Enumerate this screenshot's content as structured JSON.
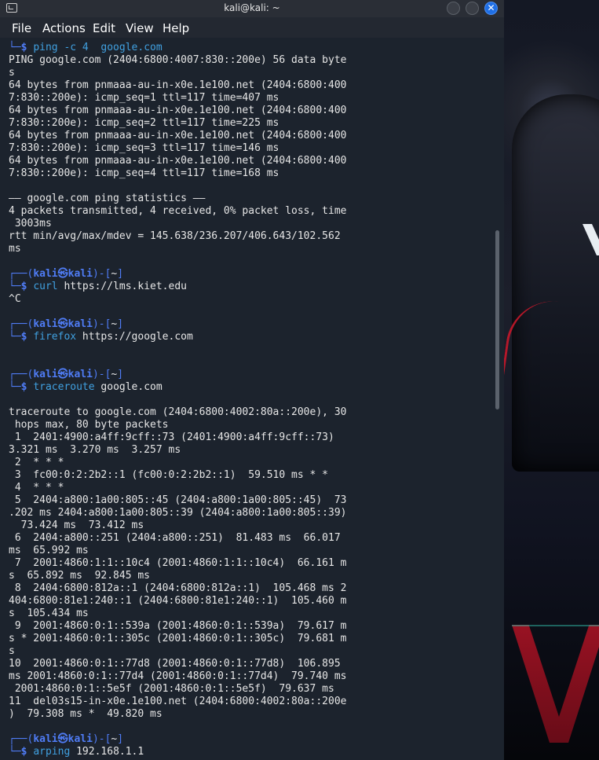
{
  "window": {
    "title": "kali@kali: ~"
  },
  "menu": [
    "File",
    "Actions",
    "Edit",
    "View",
    "Help"
  ],
  "terminal_lines": [
    {
      "t": "cmd_cont",
      "cmd": "ping -c 4  google.com"
    },
    {
      "t": "out",
      "text": "PING google.com (2404:6800:4007:830::200e) 56 data byte"
    },
    {
      "t": "out",
      "text": "s"
    },
    {
      "t": "out",
      "text": "64 bytes from pnmaaa-au-in-x0e.1e100.net (2404:6800:400"
    },
    {
      "t": "out",
      "text": "7:830::200e): icmp_seq=1 ttl=117 time=407 ms"
    },
    {
      "t": "out",
      "text": "64 bytes from pnmaaa-au-in-x0e.1e100.net (2404:6800:400"
    },
    {
      "t": "out",
      "text": "7:830::200e): icmp_seq=2 ttl=117 time=225 ms"
    },
    {
      "t": "out",
      "text": "64 bytes from pnmaaa-au-in-x0e.1e100.net (2404:6800:400"
    },
    {
      "t": "out",
      "text": "7:830::200e): icmp_seq=3 ttl=117 time=146 ms"
    },
    {
      "t": "out",
      "text": "64 bytes from pnmaaa-au-in-x0e.1e100.net (2404:6800:400"
    },
    {
      "t": "out",
      "text": "7:830::200e): icmp_seq=4 ttl=117 time=168 ms"
    },
    {
      "t": "out",
      "text": ""
    },
    {
      "t": "out",
      "text": "—— google.com ping statistics ——"
    },
    {
      "t": "out",
      "text": "4 packets transmitted, 4 received, 0% packet loss, time"
    },
    {
      "t": "out",
      "text": " 3003ms"
    },
    {
      "t": "out",
      "text": "rtt min/avg/max/mdev = 145.638/236.207/406.643/102.562"
    },
    {
      "t": "out",
      "text": "ms"
    },
    {
      "t": "out",
      "text": ""
    },
    {
      "t": "prompt_top",
      "user": "kali",
      "host": "kali",
      "dir": "~"
    },
    {
      "t": "cmd",
      "cmd": "curl",
      "arg": " https://lms.kiet.edu"
    },
    {
      "t": "out",
      "text": "^C"
    },
    {
      "t": "out",
      "text": ""
    },
    {
      "t": "prompt_top",
      "user": "kali",
      "host": "kali",
      "dir": "~"
    },
    {
      "t": "cmd",
      "cmd": "firefox",
      "arg": " https://google.com"
    },
    {
      "t": "out",
      "text": ""
    },
    {
      "t": "out",
      "text": ""
    },
    {
      "t": "prompt_top",
      "user": "kali",
      "host": "kali",
      "dir": "~"
    },
    {
      "t": "cmd",
      "cmd": "traceroute",
      "arg": " google.com"
    },
    {
      "t": "out",
      "text": ""
    },
    {
      "t": "out",
      "text": "traceroute to google.com (2404:6800:4002:80a::200e), 30"
    },
    {
      "t": "out",
      "text": " hops max, 80 byte packets"
    },
    {
      "t": "out",
      "text": " 1  2401:4900:a4ff:9cff::73 (2401:4900:a4ff:9cff::73)"
    },
    {
      "t": "out",
      "text": "3.321 ms  3.270 ms  3.257 ms"
    },
    {
      "t": "out",
      "text": " 2  * * *"
    },
    {
      "t": "out",
      "text": " 3  fc00:0:2:2b2::1 (fc00:0:2:2b2::1)  59.510 ms * *"
    },
    {
      "t": "out",
      "text": " 4  * * *"
    },
    {
      "t": "out",
      "text": " 5  2404:a800:1a00:805::45 (2404:a800:1a00:805::45)  73"
    },
    {
      "t": "out",
      "text": ".202 ms 2404:a800:1a00:805::39 (2404:a800:1a00:805::39)"
    },
    {
      "t": "out",
      "text": "  73.424 ms  73.412 ms"
    },
    {
      "t": "out",
      "text": " 6  2404:a800::251 (2404:a800::251)  81.483 ms  66.017"
    },
    {
      "t": "out",
      "text": "ms  65.992 ms"
    },
    {
      "t": "out",
      "text": " 7  2001:4860:1:1::10c4 (2001:4860:1:1::10c4)  66.161 m"
    },
    {
      "t": "out",
      "text": "s  65.892 ms  92.845 ms"
    },
    {
      "t": "out",
      "text": " 8  2404:6800:812a::1 (2404:6800:812a::1)  105.468 ms 2"
    },
    {
      "t": "out",
      "text": "404:6800:81e1:240::1 (2404:6800:81e1:240::1)  105.460 m"
    },
    {
      "t": "out",
      "text": "s  105.434 ms"
    },
    {
      "t": "out",
      "text": " 9  2001:4860:0:1::539a (2001:4860:0:1::539a)  79.617 m"
    },
    {
      "t": "out",
      "text": "s * 2001:4860:0:1::305c (2001:4860:0:1::305c)  79.681 m"
    },
    {
      "t": "out",
      "text": "s"
    },
    {
      "t": "out",
      "text": "10  2001:4860:0:1::77d8 (2001:4860:0:1::77d8)  106.895"
    },
    {
      "t": "out",
      "text": "ms 2001:4860:0:1::77d4 (2001:4860:0:1::77d4)  79.740 ms"
    },
    {
      "t": "out",
      "text": " 2001:4860:0:1::5e5f (2001:4860:0:1::5e5f)  79.637 ms"
    },
    {
      "t": "out",
      "text": "11  del03s15-in-x0e.1e100.net (2404:6800:4002:80a::200e"
    },
    {
      "t": "out",
      "text": ")  79.308 ms *  49.820 ms"
    },
    {
      "t": "out",
      "text": ""
    },
    {
      "t": "prompt_top",
      "user": "kali",
      "host": "kali",
      "dir": "~"
    },
    {
      "t": "cmd",
      "cmd": "arping",
      "arg": " 192.168.1.1"
    }
  ],
  "colors": {
    "background": "#1c232d",
    "prompt": "#4f7cf5",
    "command": "#40a0e0",
    "text": "#e6e6e6",
    "close_button": "#1f6fe5"
  }
}
